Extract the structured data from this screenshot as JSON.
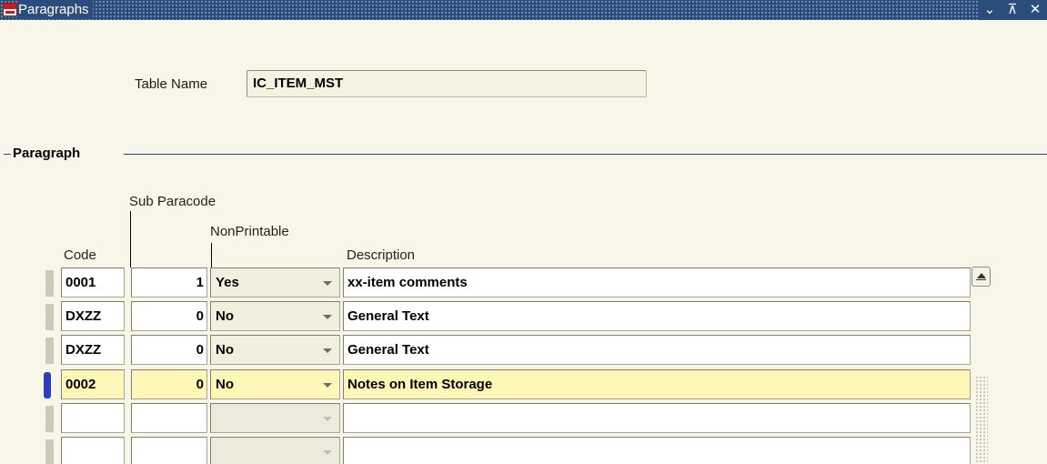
{
  "window": {
    "title": "Paragraphs",
    "controls": {
      "minimize": "⌄",
      "maximize": "⊼",
      "close": "✕"
    }
  },
  "form": {
    "table_name_label": "Table Name",
    "table_name_value": "IC_ITEM_MST"
  },
  "section": {
    "title": "Paragraph"
  },
  "columns": {
    "code": "Code",
    "sub_paracode": "Sub Paracode",
    "non_printable": "NonPrintable",
    "description": "Description"
  },
  "rows": [
    {
      "code": "0001",
      "sub": "1",
      "nonprintable": "Yes",
      "description": "xx-item comments"
    },
    {
      "code": "DXZZ",
      "sub": "0",
      "nonprintable": "No",
      "description": "General Text"
    },
    {
      "code": "DXZZ",
      "sub": "0",
      "nonprintable": "No",
      "description": "General Text"
    },
    {
      "code": "0002",
      "sub": "0",
      "nonprintable": "No",
      "description": "Notes on Item Storage"
    },
    {
      "code": "",
      "sub": "",
      "nonprintable": "",
      "description": ""
    },
    {
      "code": "",
      "sub": "",
      "nonprintable": "",
      "description": ""
    }
  ],
  "current_row_index": 3,
  "colors": {
    "titlebar": "#2a4d7b",
    "background": "#f7f6e8",
    "current_row": "#fff7b8",
    "row_indicator_active": "#2b3ec2"
  },
  "icons": {
    "app": "oracle-app-icon",
    "dropdown": "chevron-down-icon",
    "scroll_up": "scroll-up-icon"
  }
}
